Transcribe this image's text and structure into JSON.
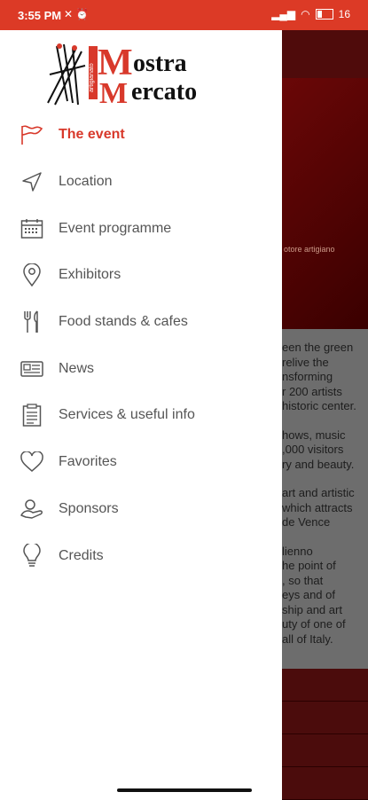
{
  "status": {
    "time": "3:55 PM",
    "battery": "16"
  },
  "logo": {
    "line1": "ostra",
    "line2": "ercato",
    "letter_m1": "M",
    "letter_m2": "M",
    "side": "artigianato"
  },
  "menu": [
    {
      "label": "The event",
      "icon": "flag-icon",
      "active": true
    },
    {
      "label": "Location",
      "icon": "navigation-arrow-icon",
      "active": false
    },
    {
      "label": "Event programme",
      "icon": "calendar-icon",
      "active": false
    },
    {
      "label": "Exhibitors",
      "icon": "map-pin-icon",
      "active": false
    },
    {
      "label": "Food stands & cafes",
      "icon": "fork-knife-icon",
      "active": false
    },
    {
      "label": "News",
      "icon": "news-icon",
      "active": false
    },
    {
      "label": "Services & useful info",
      "icon": "clipboard-icon",
      "active": false
    },
    {
      "label": "Favorites",
      "icon": "heart-icon",
      "active": false
    },
    {
      "label": "Sponsors",
      "icon": "sponsor-icon",
      "active": false
    },
    {
      "label": "Credits",
      "icon": "lightbulb-icon",
      "active": false
    }
  ],
  "background": {
    "hero_caption": "otore artigiano",
    "paragraphs": [
      [
        "een the green",
        " relive the",
        "nsforming",
        "r 200 artists",
        "historic center."
      ],
      [
        "hows, music",
        ",000 visitors",
        "ry and beauty."
      ],
      [
        "art and artistic",
        "which attracts",
        "de Vence"
      ],
      [
        "lienno",
        "he point of",
        ", so that",
        "eys and of",
        "ship and art",
        "uty of one of",
        "all of Italy."
      ]
    ]
  },
  "colors": {
    "accent": "#d8392b",
    "statusbar": "#dc3a26",
    "hero": "#5e0606"
  }
}
